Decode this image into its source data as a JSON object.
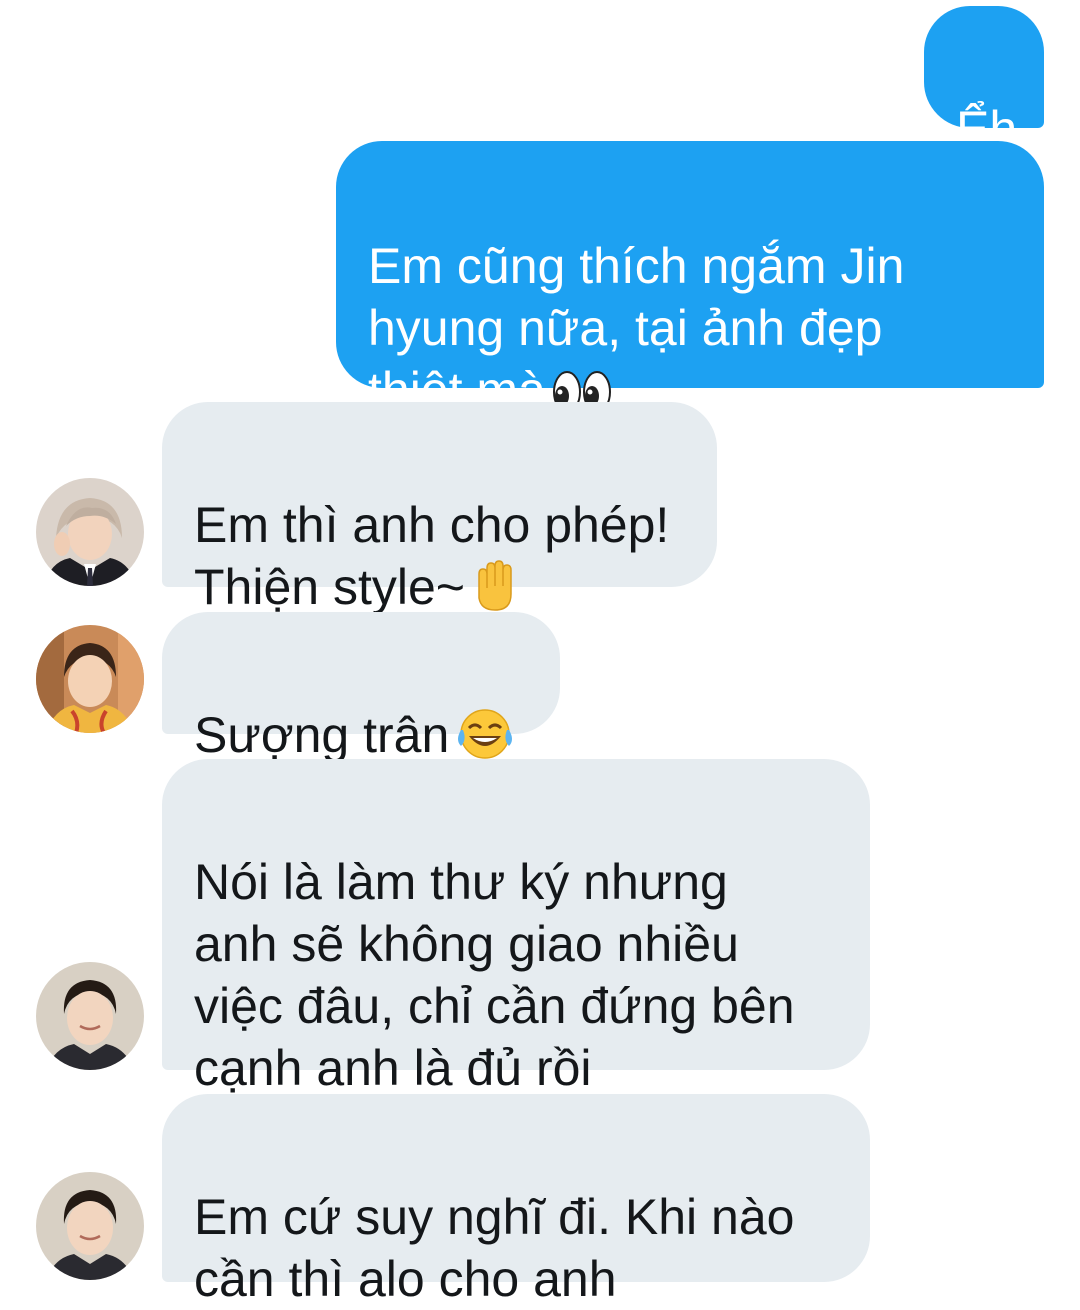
{
  "messages": [
    {
      "side": "sent",
      "text": "Ểh"
    },
    {
      "side": "sent",
      "text": "Em cũng thích ngắm Jin\nhyung nữa, tại ảnh đẹp\nthiệt mà",
      "emoji": "eyes-emoji"
    },
    {
      "side": "received",
      "text": "Em thì anh cho phép!\nThiện style~",
      "emoji": "raised-hand-emoji",
      "avatar": "avatar-1"
    },
    {
      "side": "received",
      "text": "Sượng trân",
      "emoji": "tears-of-joy-emoji",
      "avatar": "avatar-2"
    },
    {
      "side": "received",
      "text": "Nói là làm thư ký nhưng\nanh sẽ không giao nhiều\nviệc đâu, chỉ cần đứng bên\ncạnh anh là đủ rồi",
      "avatar": "avatar-3"
    },
    {
      "side": "received",
      "text": "Em cứ suy nghĩ đi. Khi nào\ncần thì alo cho anh",
      "avatar": "avatar-3"
    }
  ],
  "colors": {
    "sent_bubble": "#1da1f2",
    "received_bubble": "#e6ecf0",
    "received_text": "#14171a"
  }
}
